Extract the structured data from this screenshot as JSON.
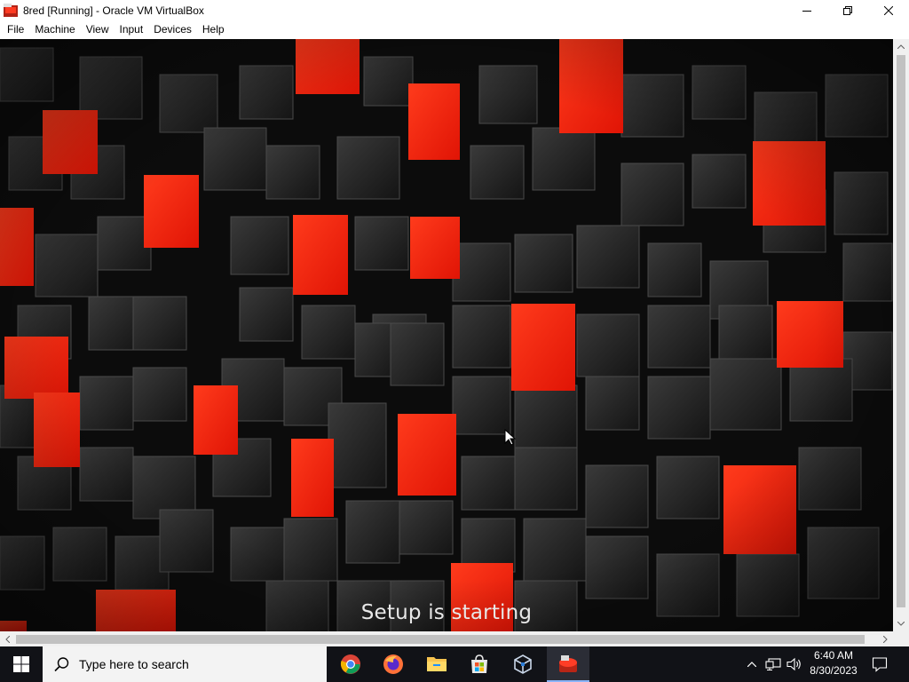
{
  "window": {
    "title": "8red [Running] - Oracle VM VirtualBox",
    "app_icon": "virtualbox-vm-icon",
    "controls": [
      "minimize-icon",
      "restore-icon",
      "close-icon"
    ]
  },
  "menu": {
    "items": [
      "File",
      "Machine",
      "View",
      "Input",
      "Devices",
      "Help"
    ]
  },
  "vm": {
    "status_text": "Setup is starting",
    "background": "red-and-black-3d-cubes-wallpaper",
    "colors": {
      "red_cube": "#ff2a12",
      "dark_cube": "#1c1c1c"
    }
  },
  "taskbar": {
    "start_icon": "windows-logo-icon",
    "search_placeholder": "Type here to search",
    "apps": [
      "chrome-icon",
      "firefox-icon",
      "file-explorer-icon",
      "microsoft-store-icon",
      "virtualbox-icon",
      "virtualbox-vm-icon"
    ],
    "tray_icons": [
      "show-hidden-icons-chevron",
      "network-icon",
      "volume-icon"
    ],
    "time": "6:40 AM",
    "date": "8/30/2023",
    "notification_icon": "action-center-icon"
  }
}
